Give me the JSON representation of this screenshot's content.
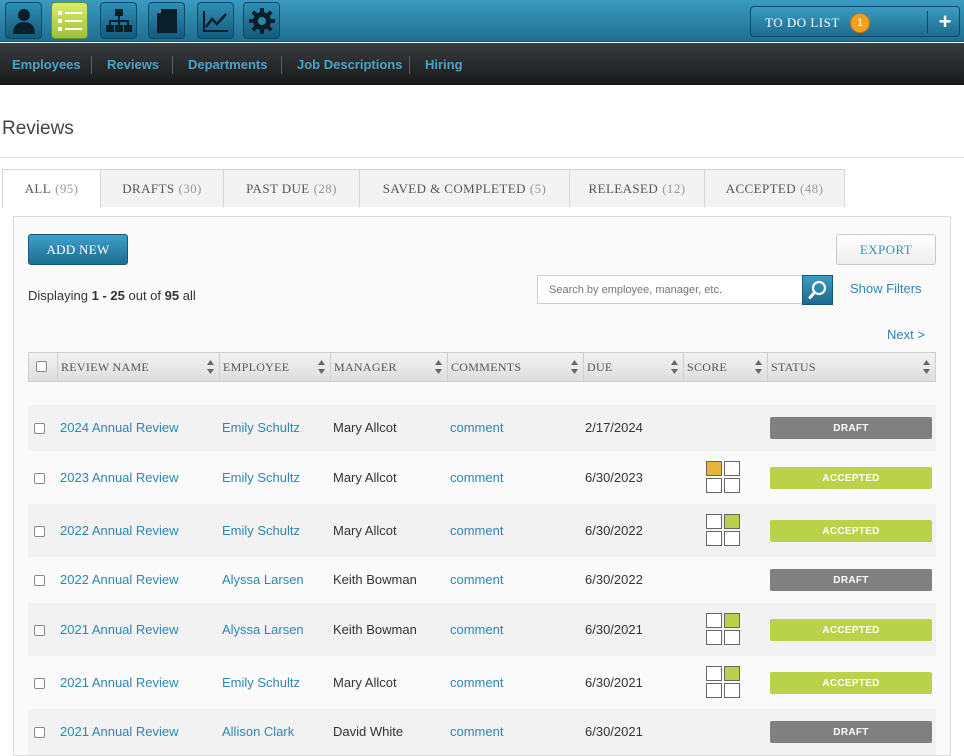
{
  "topbar": {
    "tools": [
      {
        "name": "profile-icon"
      },
      {
        "name": "list-icon"
      },
      {
        "name": "org-chart-icon"
      },
      {
        "name": "document-icon"
      },
      {
        "name": "trend-chart-icon"
      },
      {
        "name": "gear-icon"
      }
    ],
    "todo": {
      "label": "TO DO LIST",
      "count": "1",
      "add_icon": "plus-icon"
    }
  },
  "nav": {
    "items": [
      "Employees",
      "Reviews",
      "Departments",
      "Job Descriptions",
      "Hiring"
    ]
  },
  "page": {
    "title": "Reviews"
  },
  "tabs": [
    {
      "label": "ALL",
      "count": "(95)",
      "active": true
    },
    {
      "label": "DRAFTS",
      "count": "(30)"
    },
    {
      "label": "PAST DUE",
      "count": "(28)"
    },
    {
      "label": "SAVED & COMPLETED",
      "count": "(5)"
    },
    {
      "label": "RELEASED",
      "count": "(12)"
    },
    {
      "label": "ACCEPTED",
      "count": "(48)"
    }
  ],
  "toolbar": {
    "add_label": "ADD NEW",
    "export_label": "EXPORT"
  },
  "displaying": {
    "prefix": "Displaying",
    "range": "1 - 25",
    "middle": "out of",
    "total": "95",
    "suffix": "all"
  },
  "search": {
    "placeholder": "Search by employee, manager, etc.",
    "show_filters": "Show Filters"
  },
  "pagination": {
    "next": "Next >"
  },
  "table": {
    "columns": [
      "REVIEW NAME",
      "EMPLOYEE",
      "MANAGER",
      "COMMENTS",
      "DUE",
      "SCORE",
      "STATUS"
    ],
    "rows": [
      {
        "review": "2024 Annual Review",
        "employee": "Emily Schultz",
        "manager": "Mary Allcot",
        "comments": "comment",
        "due": "2/17/2024",
        "score": null,
        "status": "DRAFT"
      },
      {
        "review": "2023 Annual Review",
        "employee": "Emily Schultz",
        "manager": "Mary Allcot",
        "comments": "comment",
        "due": "6/30/2023",
        "score": {
          "cell": 0,
          "color": "#e8b53a"
        },
        "status": "ACCEPTED"
      },
      {
        "review": "2022 Annual Review",
        "employee": "Emily Schultz",
        "manager": "Mary Allcot",
        "comments": "comment",
        "due": "6/30/2022",
        "score": {
          "cell": 1,
          "color": "#b9d24a"
        },
        "status": "ACCEPTED"
      },
      {
        "review": "2022 Annual Review",
        "employee": "Alyssa Larsen",
        "manager": "Keith Bowman",
        "comments": "comment",
        "due": "6/30/2022",
        "score": null,
        "status": "DRAFT"
      },
      {
        "review": "2021 Annual Review",
        "employee": "Alyssa Larsen",
        "manager": "Keith Bowman",
        "comments": "comment",
        "due": "6/30/2021",
        "score": {
          "cell": 1,
          "color": "#b9d24a"
        },
        "status": "ACCEPTED"
      },
      {
        "review": "2021 Annual Review",
        "employee": "Emily Schultz",
        "manager": "Mary Allcot",
        "comments": "comment",
        "due": "6/30/2021",
        "score": {
          "cell": 1,
          "color": "#b9d24a"
        },
        "status": "ACCEPTED"
      },
      {
        "review": "2021 Annual Review",
        "employee": "Allison Clark",
        "manager": "David White",
        "comments": "comment",
        "due": "6/30/2021",
        "score": null,
        "status": "DRAFT"
      }
    ]
  },
  "colors": {
    "brand_blue": "#2e86b3",
    "status_draft": "#808080",
    "status_accepted": "#b9d24a",
    "todo_badge": "#f2a01e"
  }
}
